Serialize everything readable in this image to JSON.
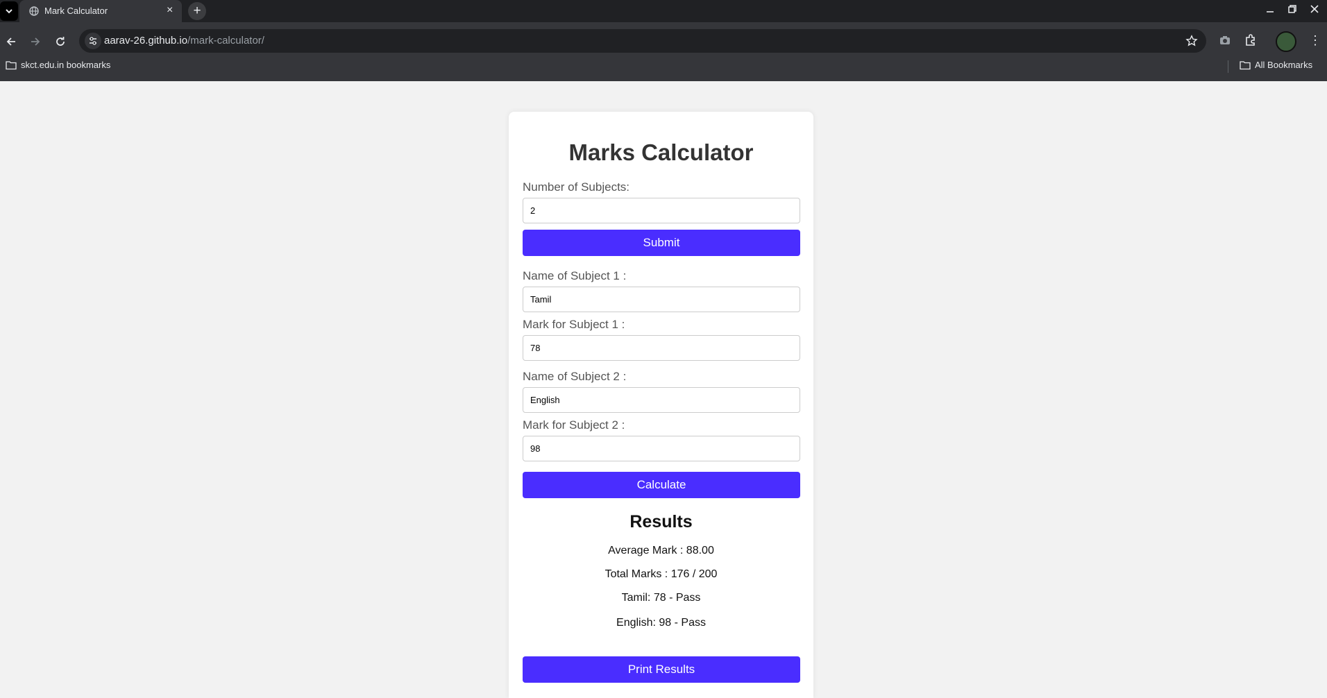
{
  "browser": {
    "tab_title": "Mark Calculator",
    "url_host": "aarav-26.github.io",
    "url_path": "/mark-calculator/",
    "bookmark_left": "skct.edu.in bookmarks",
    "bookmark_right": "All Bookmarks"
  },
  "page": {
    "title": "Marks Calculator",
    "subjects_label": "Number of Subjects:",
    "subjects_value": "2",
    "submit_label": "Submit",
    "subject1_name_label": "Name of Subject 1 :",
    "subject1_name_value": "Tamil",
    "subject1_mark_label": "Mark for Subject 1 :",
    "subject1_mark_value": "78",
    "subject2_name_label": "Name of Subject 2 :",
    "subject2_name_value": "English",
    "subject2_mark_label": "Mark for Subject 2 :",
    "subject2_mark_value": "98",
    "calculate_label": "Calculate",
    "results_title": "Results",
    "average": "Average Mark : 88.00",
    "total": "Total Marks : 176 / 200",
    "subject1_result": "Tamil: 78 - Pass",
    "subject2_result": "English: 98 - Pass",
    "print_label": "Print Results"
  },
  "colors": {
    "accent": "#4a2dff",
    "background": "#f2f2f2"
  }
}
